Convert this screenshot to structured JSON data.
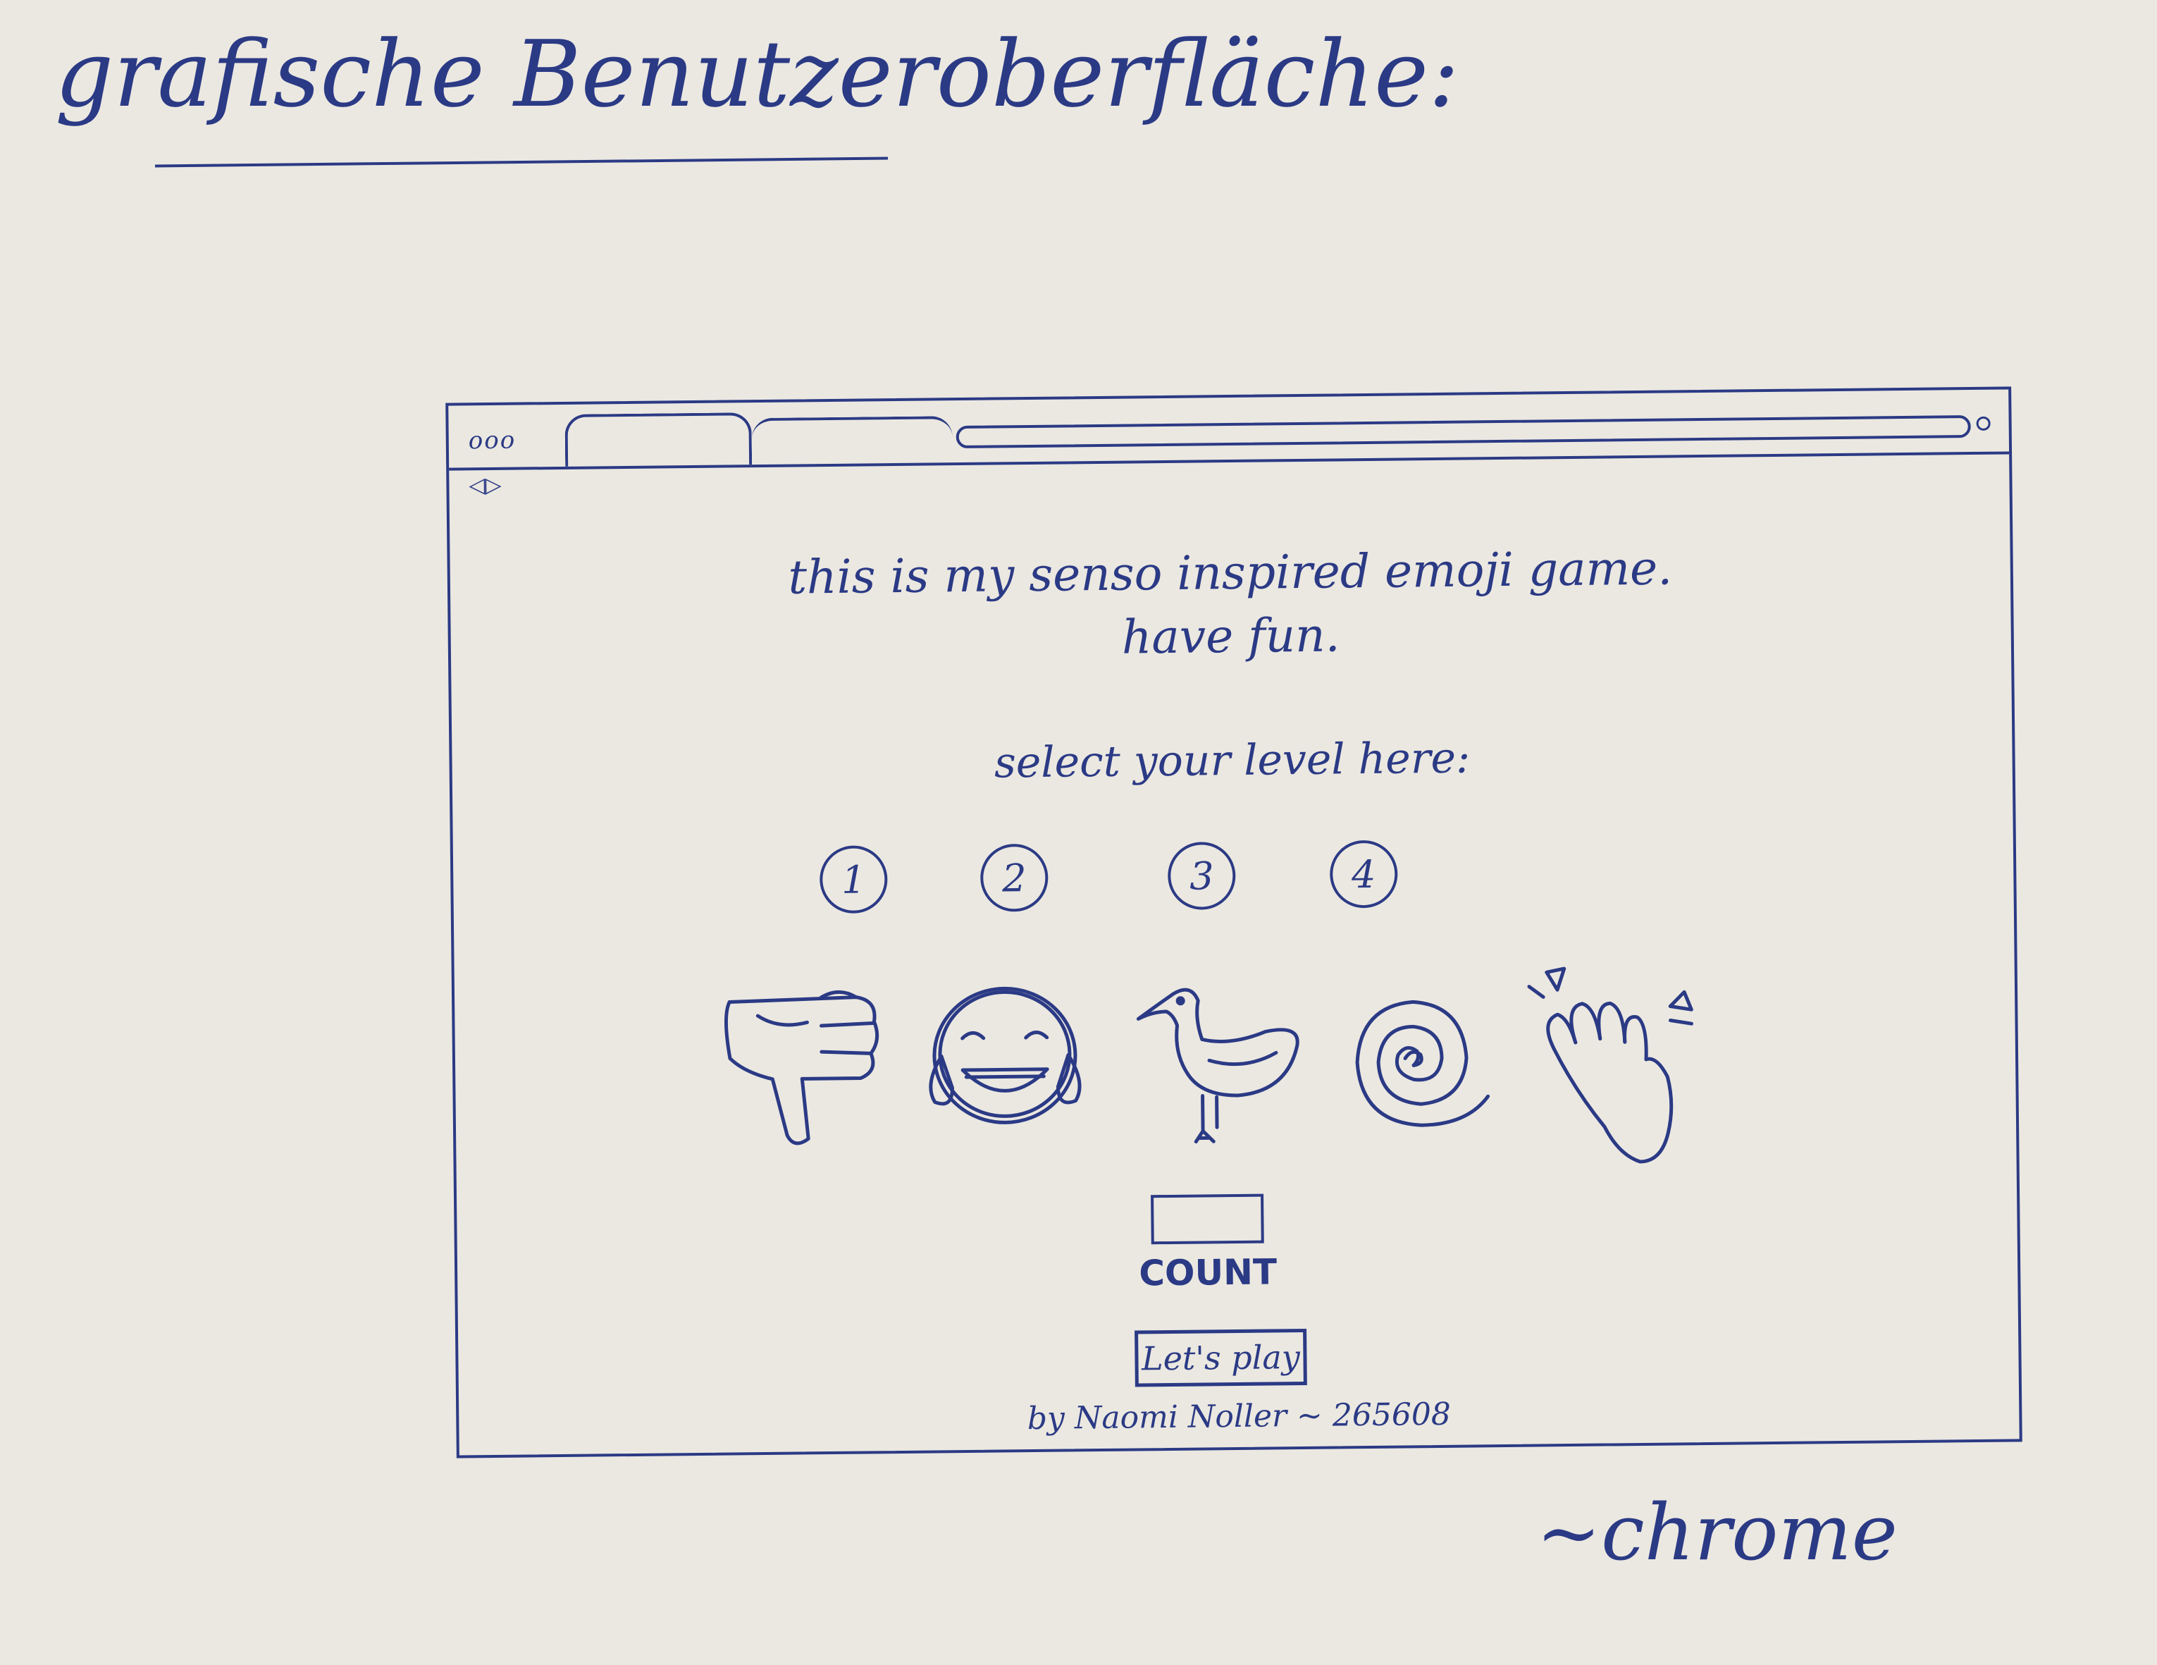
{
  "sketch": {
    "heading": "grafische Benutzeroberfläche:",
    "browser_note": "~chrome"
  },
  "browser": {
    "window_controls": "ooo",
    "nav_buttons": "◁▷"
  },
  "page": {
    "intro_line_1": "this is my senso inspired emoji game.",
    "intro_line_2": "have fun.",
    "level_prompt": "select your level here:",
    "levels": [
      "1",
      "2",
      "3",
      "4"
    ],
    "emojis": [
      {
        "icon": "thumbs-down-icon"
      },
      {
        "icon": "tears-of-joy-icon"
      },
      {
        "icon": "duck-icon"
      },
      {
        "icon": "spiral-icon"
      },
      {
        "icon": "waving-hand-icon"
      }
    ],
    "count_label": "COUNT",
    "play_button_label": "Let's play",
    "footer_credit": "by Naomi Noller ~ 265608"
  },
  "colors": {
    "ink": "#2b3a85",
    "paper": "#ebe8e1"
  }
}
